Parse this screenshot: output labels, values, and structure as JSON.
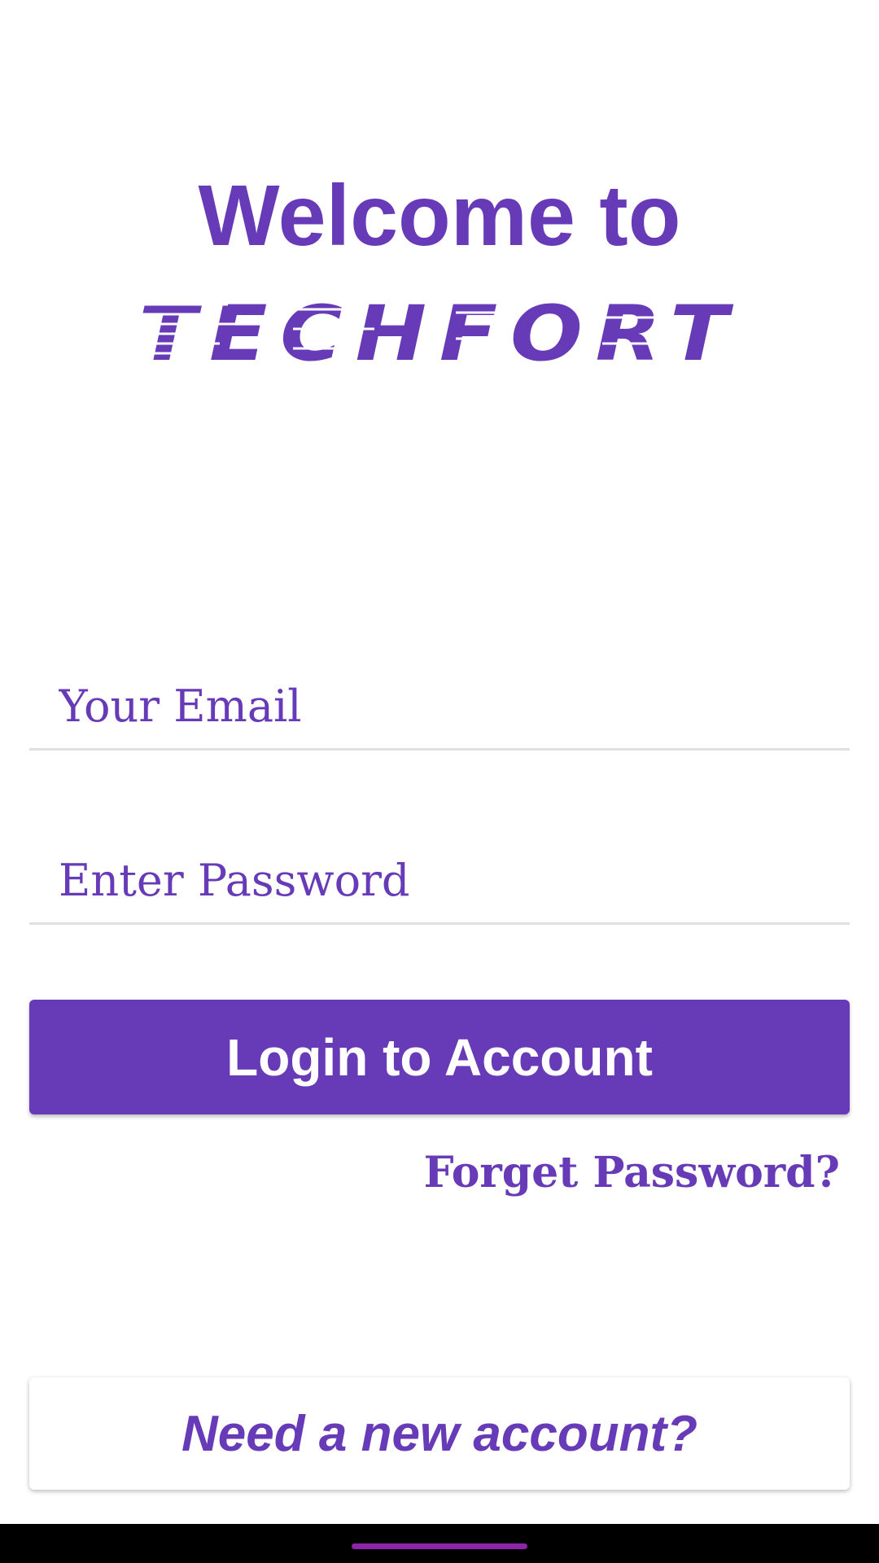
{
  "header": {
    "welcome_text": "Welcome to",
    "logo_text": "TechFort"
  },
  "form": {
    "email_placeholder": "Your Email",
    "password_placeholder": "Enter Password",
    "login_label": "Login to Account",
    "forgot_label": "Forget Password?"
  },
  "footer": {
    "new_account_label": "Need a new account?"
  },
  "colors": {
    "accent": "#673ab7",
    "nav_bar": "#000000",
    "home_handle": "#8e24aa"
  }
}
